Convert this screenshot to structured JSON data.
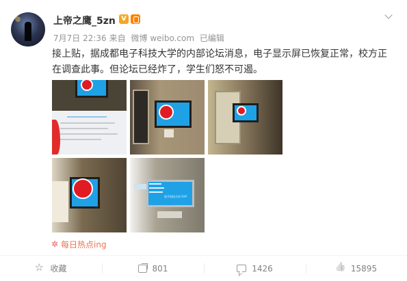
{
  "post": {
    "username": "上帝之鹰_5zn",
    "verified_badge": "V",
    "date": "7月7日 22:36",
    "source_prefix": "来自",
    "source_app": "微博 weibo.com",
    "edited": "已编辑",
    "text": "接上贴，据成都电子科技大学的内部论坛消息，电子显示屏已恢复正常，校方正在调查此事。但论坛已经炸了，学生们怒不可遏。",
    "images_count": 5,
    "image_5_caption": "电子科技大学 EVP",
    "hashtag": "每日热点ing"
  },
  "actions": {
    "favorite_label": "收藏",
    "share_count": "801",
    "comment_count": "1426",
    "like_count": "15895"
  },
  "icons": [
    "more-chevron-icon",
    "star-icon",
    "share-icon",
    "comment-icon",
    "like-icon",
    "hot-topic-icon"
  ],
  "colors": {
    "accent": "#eb7350",
    "verified": "#f6a623",
    "screen": "#1fa1e6",
    "text": "#333333",
    "meta": "#939393"
  }
}
